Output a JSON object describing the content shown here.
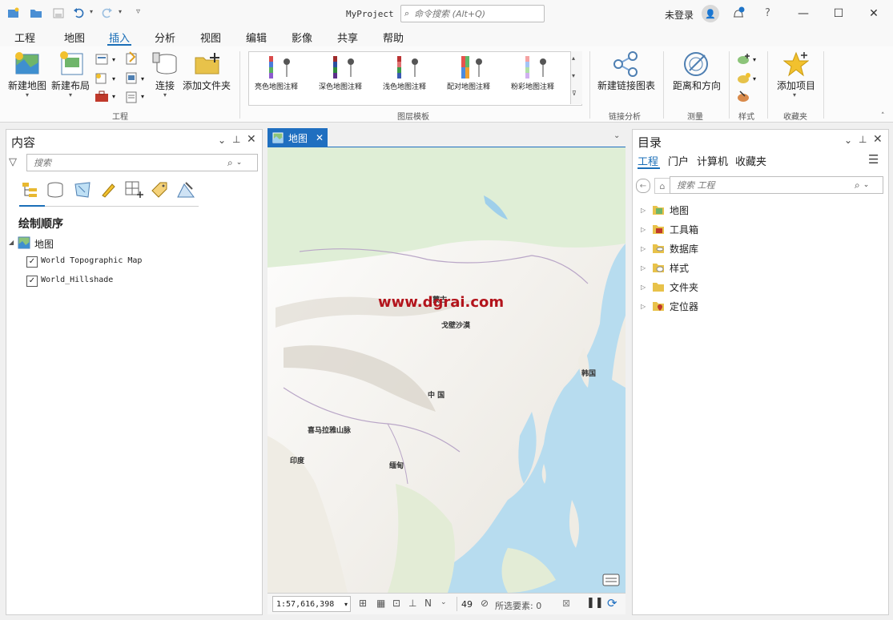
{
  "window": {
    "title": "MyProject",
    "command_search_placeholder": "命令搜索 (Alt+Q)",
    "user": "未登录",
    "help": "?"
  },
  "tabs": [
    "工程",
    "地图",
    "插入",
    "分析",
    "视图",
    "编辑",
    "影像",
    "共享",
    "帮助"
  ],
  "active_tab": "插入",
  "ribbon": {
    "project_group": {
      "label": "工程",
      "new_map": "新建地图",
      "new_layout": "新建布局",
      "connect": "连接",
      "add_folder": "添加文件夹"
    },
    "layer_templates": {
      "label": "图层模板",
      "items": [
        "亮色地图注释",
        "深色地图注释",
        "浅色地图注释",
        "配对地图注释",
        "粉彩地图注释"
      ]
    },
    "link_analysis": {
      "label": "链接分析",
      "new_link_chart": "新建链接图表"
    },
    "measure": {
      "label": "测量",
      "distance_direction": "距离和方向"
    },
    "styles": {
      "label": "样式"
    },
    "favorites": {
      "label": "收藏夹",
      "add_item": "添加项目"
    }
  },
  "contents": {
    "title": "内容",
    "search_placeholder": "搜索",
    "drawing_order": "绘制顺序",
    "map_name": "地图",
    "layers": [
      {
        "name": "World Topographic Map",
        "checked": true
      },
      {
        "name": "World_Hillshade",
        "checked": true
      }
    ]
  },
  "map_view": {
    "tab": "地图",
    "watermark": "www.dgrai.com",
    "labels": {
      "mongolia": "蒙古",
      "gobi": "戈壁沙漠",
      "china": "中 国",
      "himalaya": "喜马拉雅山脉",
      "india": "印度",
      "myanmar": "缅甸",
      "korea": "韩国"
    },
    "scale": "1:57,616,398",
    "count": "49",
    "selected_features": "所选要素: 0"
  },
  "catalog": {
    "title": "目录",
    "tabs": [
      "工程",
      "门户",
      "计算机",
      "收藏夹"
    ],
    "search_placeholder": "搜索 工程",
    "items": [
      "地图",
      "工具箱",
      "数据库",
      "样式",
      "文件夹",
      "定位器"
    ]
  }
}
